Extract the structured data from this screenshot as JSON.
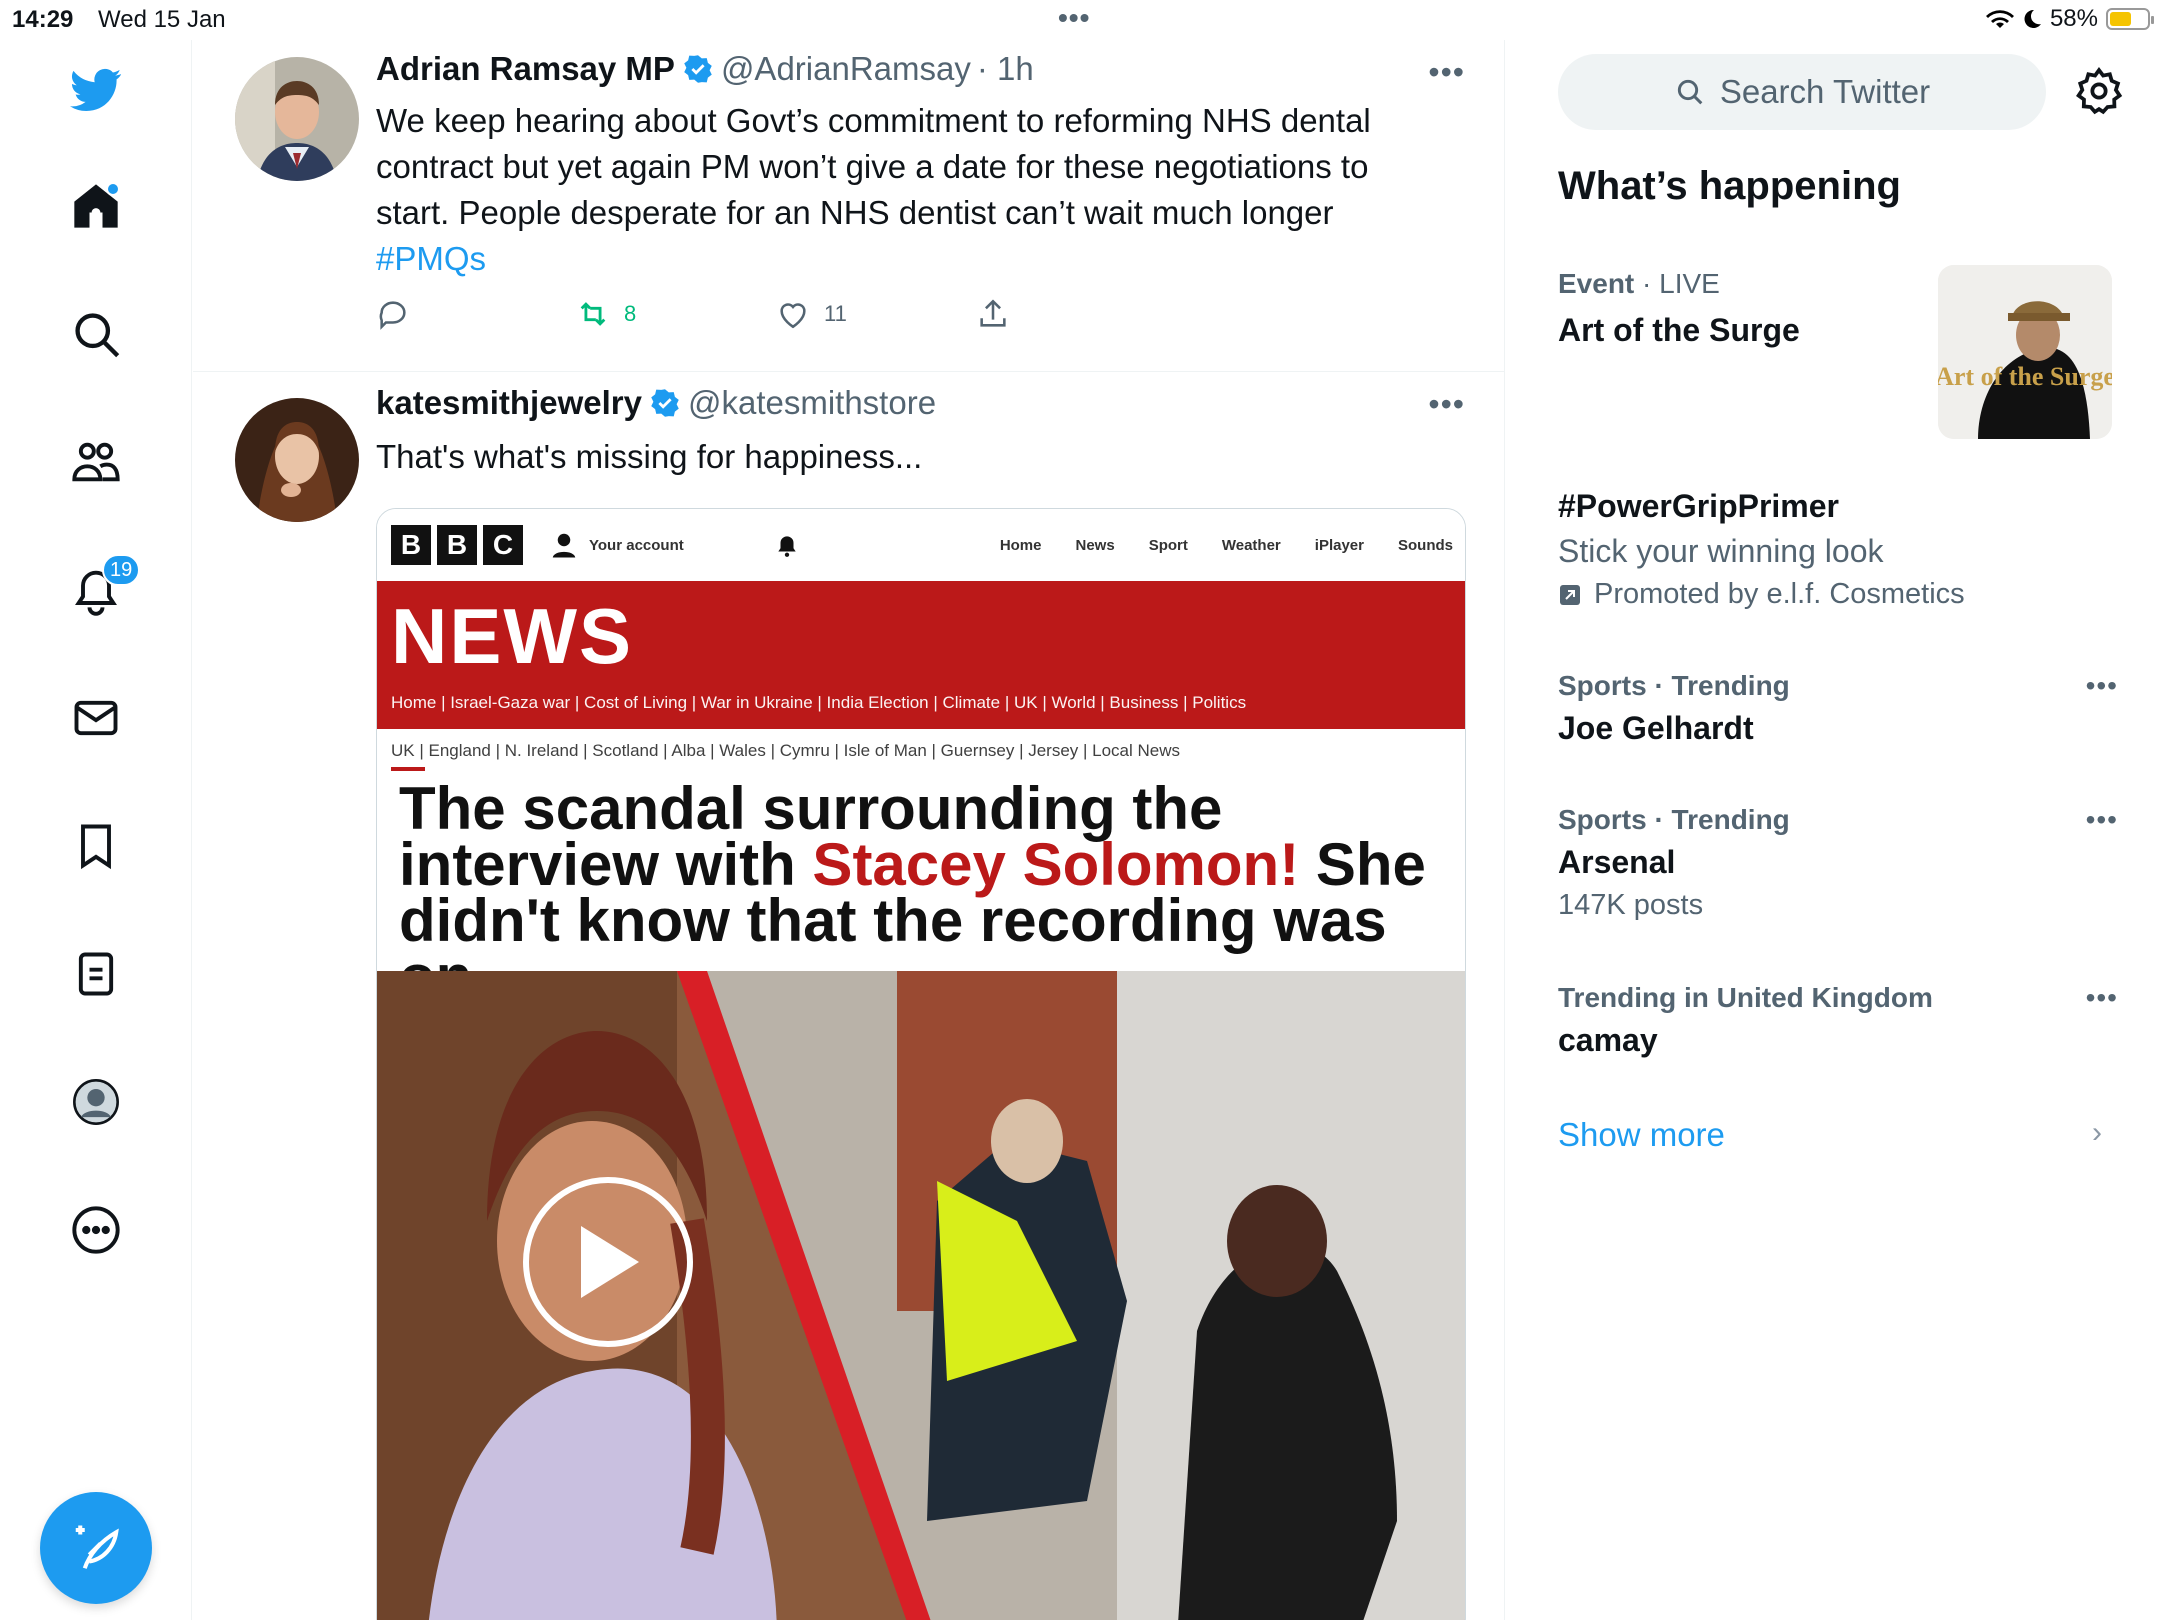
{
  "status": {
    "time": "14:29",
    "date": "Wed 15 Jan",
    "battery": "58%",
    "battery_level": 0.58
  },
  "nav": {
    "notifications_badge": "19"
  },
  "tweets": [
    {
      "name": "Adrian Ramsay MP",
      "handle": "@AdrianRamsay",
      "time": "· 1h",
      "text": "We keep hearing about Govt’s commitment to reforming NHS dental contract but yet again PM won’t give a date for these negotiations to start. People desperate for an NHS dentist can’t wait much longer",
      "hashtag": "#PMQs",
      "retweets": "8",
      "likes": "11"
    },
    {
      "name": "katesmithjewelry",
      "handle": "@katesmithstore",
      "text": "That's what's missing for happiness..."
    }
  ],
  "card": {
    "bbc_logo": [
      "B",
      "B",
      "C"
    ],
    "your_account": "Your account",
    "nav": [
      "Home",
      "News",
      "Sport",
      "Weather",
      "iPlayer",
      "Sounds"
    ],
    "news": "NEWS",
    "sub_nav": "Home | Israel-Gaza war | Cost of Living | War in Ukraine | India Election | Climate | UK | World | Business | Politics",
    "sub_nav2": "UK | England | N. Ireland | Scotland | Alba | Wales | Cymru | Isle of Man | Guernsey | Jersey | Local News",
    "headline_1": "The scandal surrounding the interview with ",
    "headline_red": "Stacey Solomon!",
    "headline_2": " She didn't know that the recording was on."
  },
  "sidebar": {
    "search_placeholder": "Search Twitter",
    "whats_happening": "What’s happening",
    "trends": [
      {
        "category": "Event",
        "meta": "· LIVE",
        "title": "Art of the Surge"
      },
      {
        "title": "#PowerGripPrimer",
        "sub": "Stick your winning look",
        "promoted": "Promoted by e.l.f. Cosmetics"
      },
      {
        "meta": "Sports · Trending",
        "title": "Joe Gelhardt"
      },
      {
        "meta": "Sports · Trending",
        "title": "Arsenal",
        "sub": "147K posts"
      },
      {
        "meta": "Trending in United Kingdom",
        "title": "camay"
      }
    ],
    "event_image_text": "Art of the Surge",
    "show_more": "Show more"
  }
}
